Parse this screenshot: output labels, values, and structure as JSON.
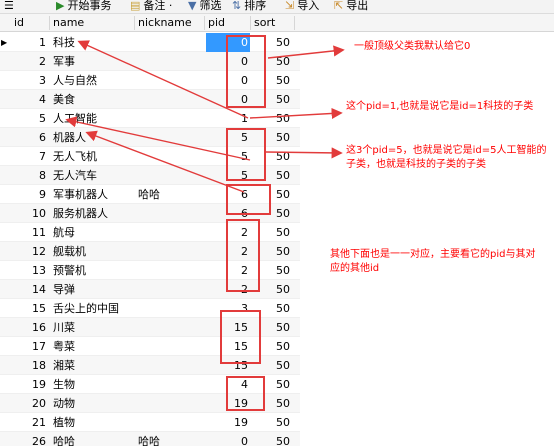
{
  "toolbar": {
    "menu_icon": "hamburger-icon",
    "items": [
      {
        "label": "开始事务",
        "icon": "begin-transaction-icon"
      },
      {
        "label": "备注 ·",
        "icon": "note-icon"
      },
      {
        "label": "筛选",
        "icon": "filter-icon"
      },
      {
        "label": "排序",
        "icon": "sort-icon"
      },
      {
        "label": "导入",
        "icon": "import-icon"
      },
      {
        "label": "导出",
        "icon": "export-icon"
      }
    ]
  },
  "table": {
    "columns": [
      "id",
      "name",
      "nickname",
      "pid",
      "sort"
    ],
    "rows": [
      {
        "id": "1",
        "name": "科技",
        "nickname": "",
        "pid": "0",
        "sort": "50"
      },
      {
        "id": "2",
        "name": "军事",
        "nickname": "",
        "pid": "0",
        "sort": "50"
      },
      {
        "id": "3",
        "name": "人与自然",
        "nickname": "",
        "pid": "0",
        "sort": "50"
      },
      {
        "id": "4",
        "name": "美食",
        "nickname": "",
        "pid": "0",
        "sort": "50"
      },
      {
        "id": "5",
        "name": "人工智能",
        "nickname": "",
        "pid": "1",
        "sort": "50"
      },
      {
        "id": "6",
        "name": "机器人",
        "nickname": "",
        "pid": "5",
        "sort": "50"
      },
      {
        "id": "7",
        "name": "无人飞机",
        "nickname": "",
        "pid": "5",
        "sort": "50"
      },
      {
        "id": "8",
        "name": "无人汽车",
        "nickname": "",
        "pid": "5",
        "sort": "50"
      },
      {
        "id": "9",
        "name": "军事机器人",
        "nickname": "哈哈",
        "pid": "6",
        "sort": "50"
      },
      {
        "id": "10",
        "name": "服务机器人",
        "nickname": "",
        "pid": "6",
        "sort": "50"
      },
      {
        "id": "11",
        "name": "航母",
        "nickname": "",
        "pid": "2",
        "sort": "50"
      },
      {
        "id": "12",
        "name": "舰载机",
        "nickname": "",
        "pid": "2",
        "sort": "50"
      },
      {
        "id": "13",
        "name": "预警机",
        "nickname": "",
        "pid": "2",
        "sort": "50"
      },
      {
        "id": "14",
        "name": "导弹",
        "nickname": "",
        "pid": "2",
        "sort": "50"
      },
      {
        "id": "15",
        "name": "舌尖上的中国",
        "nickname": "",
        "pid": "3",
        "sort": "50"
      },
      {
        "id": "16",
        "name": "川菜",
        "nickname": "",
        "pid": "15",
        "sort": "50"
      },
      {
        "id": "17",
        "name": "粤菜",
        "nickname": "",
        "pid": "15",
        "sort": "50"
      },
      {
        "id": "18",
        "name": "湘菜",
        "nickname": "",
        "pid": "15",
        "sort": "50"
      },
      {
        "id": "19",
        "name": "生物",
        "nickname": "",
        "pid": "4",
        "sort": "50"
      },
      {
        "id": "20",
        "name": "动物",
        "nickname": "",
        "pid": "19",
        "sort": "50"
      },
      {
        "id": "21",
        "name": "植物",
        "nickname": "",
        "pid": "19",
        "sort": "50"
      },
      {
        "id": "26",
        "name": "哈哈",
        "nickname": "哈哈",
        "pid": "0",
        "sort": "50"
      }
    ]
  },
  "annotations": {
    "a1": "一般顶级父类我默认给它0",
    "a2": "这个pid=1,也就是说它是id=1科技的子类",
    "a3": "这3个pid=5，也就是说它是id=5人工智能的子类，也就是科技的子类的子类",
    "a4": "其他下面也是一一对应，主要看它的pid与其对应的其他id"
  },
  "colors": {
    "annotation": "#ff0000",
    "box": "#e23b3b",
    "selection": "#3399ff"
  }
}
